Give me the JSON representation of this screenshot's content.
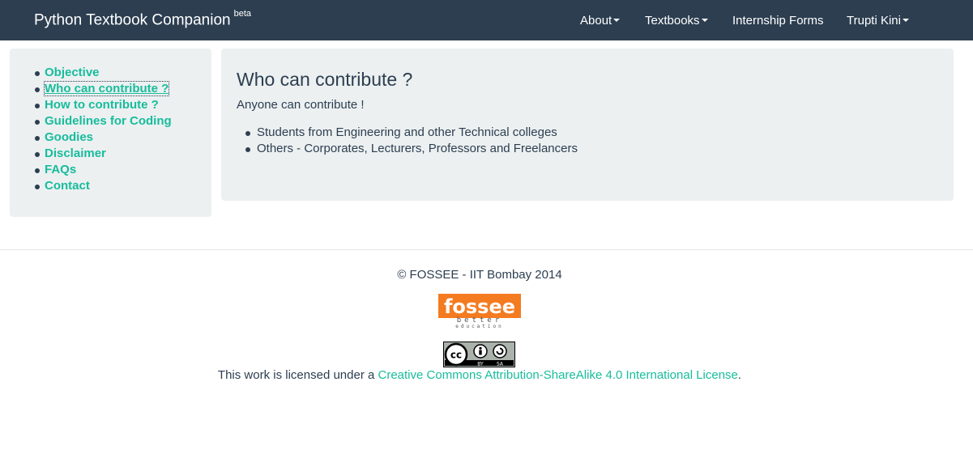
{
  "navbar": {
    "brand": "Python Textbook Companion",
    "brand_sup": "beta",
    "items": [
      {
        "label": "About",
        "dropdown": true
      },
      {
        "label": "Textbooks",
        "dropdown": true
      },
      {
        "label": "Internship Forms",
        "dropdown": false
      },
      {
        "label": "Trupti Kini",
        "dropdown": true
      }
    ]
  },
  "sidebar": {
    "items": [
      {
        "label": "Objective"
      },
      {
        "label": "Who can contribute ?",
        "active": true
      },
      {
        "label": "How to contribute ?"
      },
      {
        "label": "Guidelines for Coding"
      },
      {
        "label": "Goodies"
      },
      {
        "label": "Disclaimer"
      },
      {
        "label": "FAQs"
      },
      {
        "label": "Contact"
      }
    ]
  },
  "main": {
    "heading": "Who can contribute ?",
    "intro": "Anyone can contribute !",
    "list": [
      "Students from Engineering and other Technical colleges",
      "Others - Corporates, Lecturers, Professors and Freelancers"
    ]
  },
  "footer": {
    "copyright": "© FOSSEE - IIT Bombay 2014",
    "logo": {
      "line1": "fossee",
      "line2": "better",
      "line3": "education"
    },
    "cc_badge": {
      "by": "BY",
      "sa": "SA"
    },
    "license_prefix": "This work is licensed under a ",
    "license_link": "Creative Commons Attribution-ShareAlike 4.0 International License",
    "license_suffix": "."
  },
  "colors": {
    "navbar_bg": "#2c3e50",
    "accent": "#18bc9c",
    "panel_bg": "#ecf0f1",
    "logo_orange": "#f47b20"
  }
}
